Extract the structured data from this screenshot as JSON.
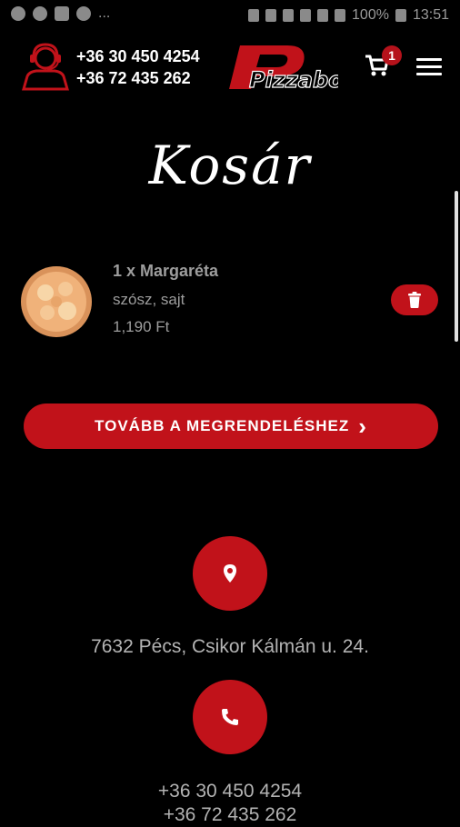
{
  "status_bar": {
    "left_more": "...",
    "battery": "100%",
    "time": "13:51"
  },
  "header": {
    "phone_1": "+36 30 450 4254",
    "phone_2": "+36 72 435 262",
    "logo_text": "Pizzaboy",
    "cart_count": "1",
    "accent_color": "#c1121a"
  },
  "page": {
    "title": "Kosár"
  },
  "cart_items": [
    {
      "name": "1 x Margaréta",
      "description": "szósz, sajt",
      "price": "1,190 Ft"
    }
  ],
  "checkout": {
    "label": "TOVÁBB A MEGRENDELÉSHEZ",
    "chevron": "›"
  },
  "contact": {
    "address": "7632 Pécs, Csikor Kálmán u. 24.",
    "phone_1": "+36 30 450 4254",
    "phone_2": "+36 72 435 262"
  }
}
